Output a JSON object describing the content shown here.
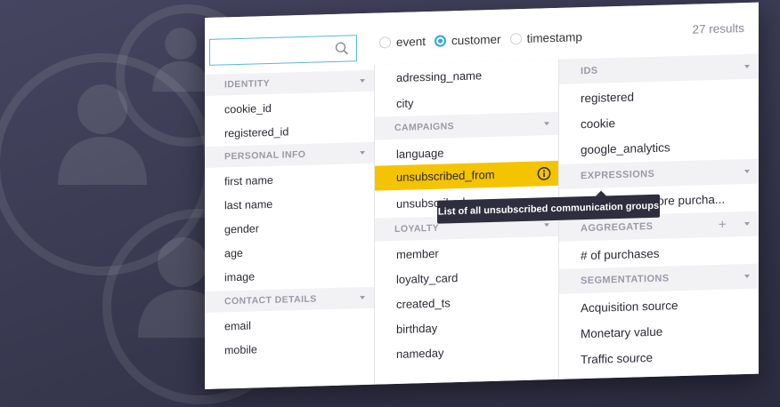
{
  "search": {
    "placeholder": ""
  },
  "filter": {
    "options": [
      "event",
      "customer",
      "timestamp"
    ],
    "selected": "customer"
  },
  "results": "27 results",
  "column1": {
    "sections": [
      {
        "label": "IDENTITY",
        "items": [
          "cookie_id",
          "registered_id"
        ]
      },
      {
        "label": "PERSONAL INFO",
        "items": [
          "first name",
          "last name",
          "gender",
          "age",
          "image"
        ]
      },
      {
        "label": "CONTACT DETAILS",
        "items": [
          "email",
          "mobile"
        ]
      }
    ]
  },
  "column2": {
    "top_items": [
      "adressing_name",
      "city"
    ],
    "sections": [
      {
        "label": "CAMPAIGNS",
        "items": [
          "language",
          "unsubscribed_from",
          "unsubscribed"
        ]
      },
      {
        "label": "LOYALTY",
        "items": [
          "member",
          "loyalty_card",
          "created_ts",
          "birthday",
          "nameday"
        ]
      }
    ],
    "selected": "unsubscribed_from"
  },
  "column3": {
    "sections": [
      {
        "label": "IDS",
        "items": [
          "registered",
          "cookie",
          "google_analytics"
        ]
      },
      {
        "label": "EXPRESSIONS",
        "items": [
          "# sessions before purcha..."
        ]
      },
      {
        "label": "AGGREGATES",
        "items": [
          "# of purchases"
        ]
      },
      {
        "label": "SEGMENTATIONS",
        "items": [
          "Acquisition source",
          "Monetary value",
          "Traffic source"
        ]
      }
    ]
  },
  "tooltip": "List of all unsubscribed communication groups",
  "colors": {
    "accent": "#29a8d6",
    "highlight": "#f5c400",
    "tooltip_bg": "#2e2e3e"
  },
  "icons": {
    "search": "search-icon",
    "info": "info-icon",
    "add": "plus-icon",
    "expand": "chevron-down-icon"
  }
}
